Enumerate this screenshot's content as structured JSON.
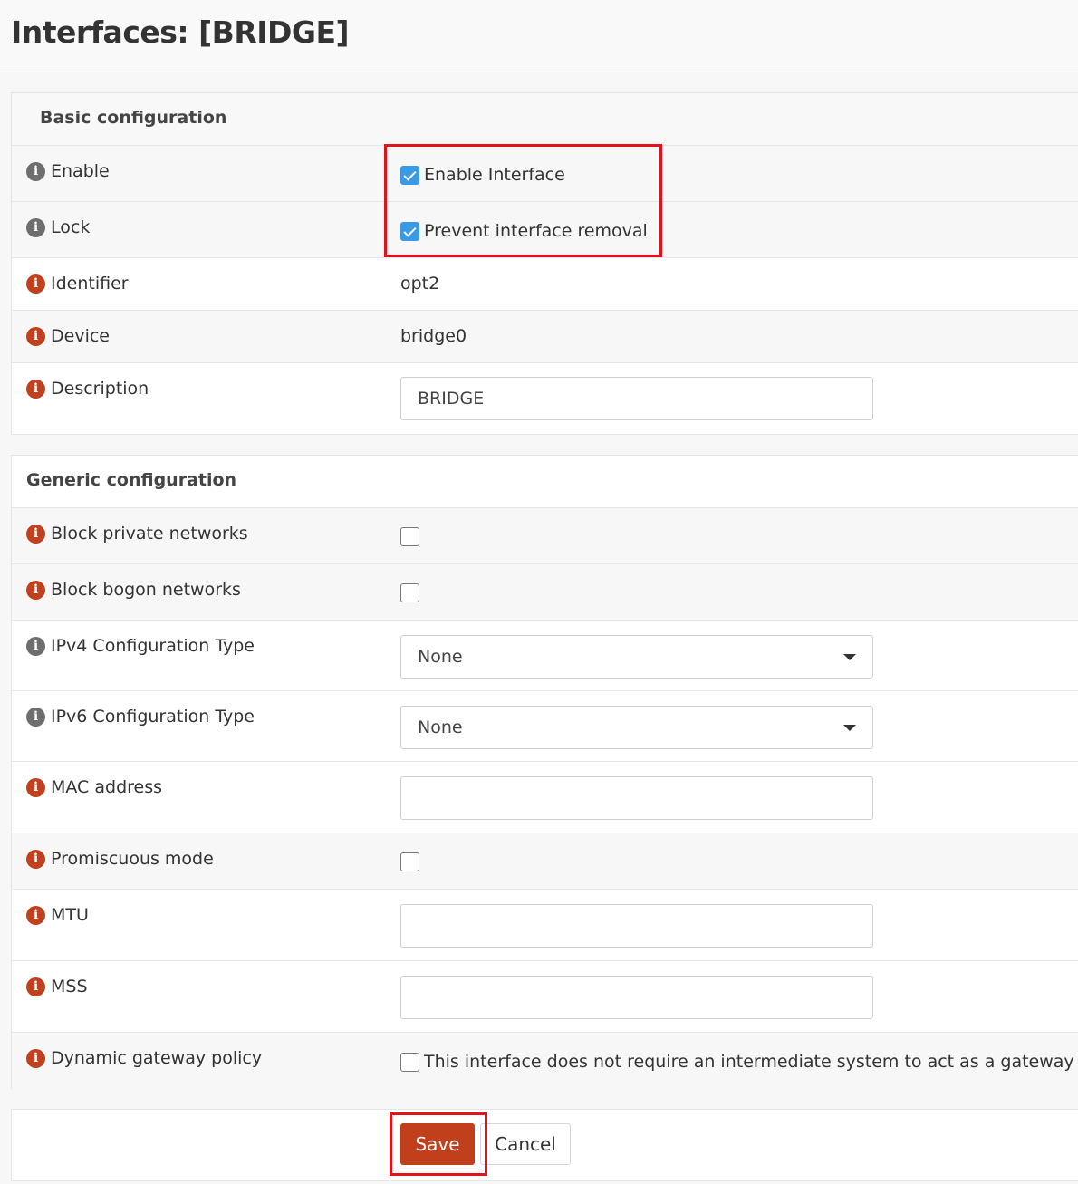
{
  "page": {
    "title": "Interfaces: [BRIDGE]"
  },
  "basic": {
    "heading": "Basic configuration",
    "enable": {
      "label": "Enable",
      "checkbox_label": "Enable Interface",
      "checked": true
    },
    "lock": {
      "label": "Lock",
      "checkbox_label": "Prevent interface removal",
      "checked": true
    },
    "identifier": {
      "label": "Identifier",
      "value": "opt2"
    },
    "device": {
      "label": "Device",
      "value": "bridge0"
    },
    "description": {
      "label": "Description",
      "value": "BRIDGE"
    }
  },
  "generic": {
    "heading": "Generic configuration",
    "block_private": {
      "label": "Block private networks",
      "checked": false
    },
    "block_bogon": {
      "label": "Block bogon networks",
      "checked": false
    },
    "ipv4_type": {
      "label": "IPv4 Configuration Type",
      "selected": "None"
    },
    "ipv6_type": {
      "label": "IPv6 Configuration Type",
      "selected": "None"
    },
    "mac": {
      "label": "MAC address",
      "value": ""
    },
    "promisc": {
      "label": "Promiscuous mode",
      "checked": false
    },
    "mtu": {
      "label": "MTU",
      "value": ""
    },
    "mss": {
      "label": "MSS",
      "value": ""
    },
    "dyn_gw": {
      "label": "Dynamic gateway policy",
      "checkbox_label": "This interface does not require an intermediate system to act as a gateway",
      "checked": false
    }
  },
  "actions": {
    "save_label": "Save",
    "cancel_label": "Cancel"
  },
  "colors": {
    "accent": "#c23f1b",
    "checkbox": "#3b9ae6",
    "highlight": "#e0131b",
    "info_grey": "#6e6e6e",
    "info_red": "#c1401d"
  }
}
